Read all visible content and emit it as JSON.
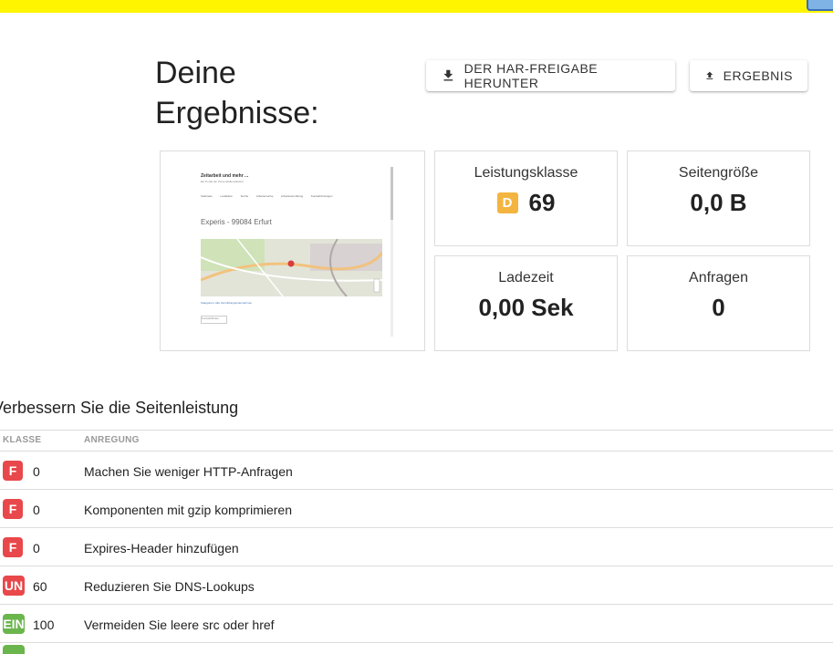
{
  "header": {
    "title": "Deine Ergebnisse:"
  },
  "buttons": {
    "download_har": "DER HAR-FREIGABE HERUNTER",
    "result": "ERGEBNIS"
  },
  "thumbnail": {
    "site_title": "Zeitarbeit und mehr ...",
    "site_subtitle": "Ein Portal der Personaldienstleister",
    "nav": "Startseite Landkarte Suche Arbeitersuche Arbeitsvermittlung Kontakt/Anzeigen",
    "heading": "Experis - 99084 Erfurt",
    "link_text": "Kategorien: Alle Vermittlungsunternehmen",
    "button_text": "Kontakt/Rufen"
  },
  "metrics": {
    "performance": {
      "label": "Leistungsklasse",
      "grade": "D",
      "value": "69",
      "grade_color": "#f3b53f"
    },
    "page_size": {
      "label": "Seitengröße",
      "value": "0,0 B"
    },
    "load_time": {
      "label": "Ladezeit",
      "value": "0,00 Sek"
    },
    "requests": {
      "label": "Anfragen",
      "value": "0"
    }
  },
  "improve": {
    "title": "Verbessern Sie die Seitenleistung",
    "headers": {
      "grade": "KLASSE",
      "suggestion": "ANREGUNG"
    },
    "rows": [
      {
        "grade": "F",
        "score": "0",
        "text": "Machen Sie weniger HTTP-Anfragen"
      },
      {
        "grade": "F",
        "score": "0",
        "text": "Komponenten mit gzip komprimieren"
      },
      {
        "grade": "F",
        "score": "0",
        "text": "Expires-Header hinzufügen"
      },
      {
        "grade": "UN",
        "score": "60",
        "text": "Reduzieren Sie DNS-Lookups"
      },
      {
        "grade": "EIN",
        "score": "100",
        "text": "Vermeiden Sie leere src oder href"
      }
    ]
  },
  "colors": {
    "top_bar": "#fff500",
    "grade_f": "#e8484b",
    "grade_ein": "#6bb54d",
    "grade_d": "#f3b53f"
  }
}
